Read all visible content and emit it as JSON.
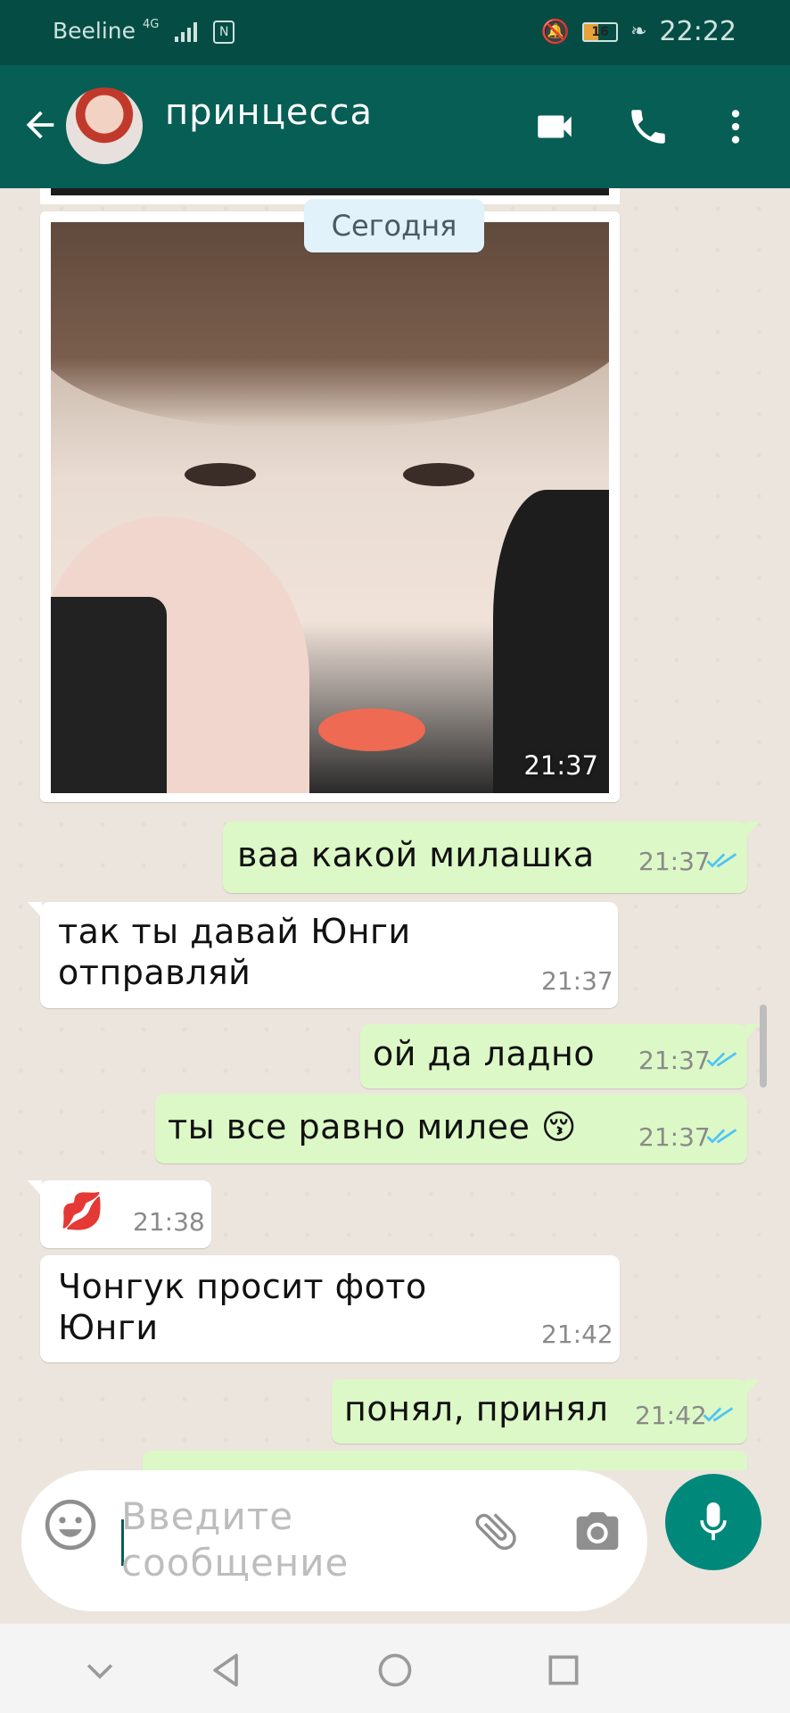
{
  "status": {
    "carrier": "Beeline",
    "network": "4G",
    "battery": "16",
    "time": "22:22"
  },
  "header": {
    "contact_name": "принцесса"
  },
  "chat": {
    "date_chip": "Сегодня",
    "photo_time": "21:37",
    "messages": [
      {
        "dir": "out",
        "text": "ваа какой милашка",
        "time": "21:37"
      },
      {
        "dir": "in",
        "text": "так ты давай Юнги\nотправляй",
        "time": "21:37"
      },
      {
        "dir": "out",
        "text": "ой да ладно",
        "time": "21:37"
      },
      {
        "dir": "out",
        "text": "ты все равно милее 😚",
        "time": "21:37"
      },
      {
        "dir": "in",
        "text": "💋",
        "time": "21:38"
      },
      {
        "dir": "in",
        "text": "Чонгук просит фото\nЮнги",
        "time": "21:42"
      },
      {
        "dir": "out",
        "text": "понял, принял",
        "time": "21:42"
      }
    ]
  },
  "composer": {
    "placeholder": "Введите\nсообщение"
  },
  "colors": {
    "header": "#075e54",
    "status_bar": "#054d44",
    "outgoing": "#dcf8c6",
    "incoming": "#ffffff",
    "accent": "#00897b",
    "read_ticks": "#4fc3f7"
  },
  "icons": [
    "back-arrow-icon",
    "video-call-icon",
    "phone-icon",
    "more-vert-icon",
    "emoji-icon",
    "attach-icon",
    "camera-icon",
    "mic-icon",
    "nav-back-icon",
    "nav-home-icon",
    "nav-recents-icon"
  ]
}
